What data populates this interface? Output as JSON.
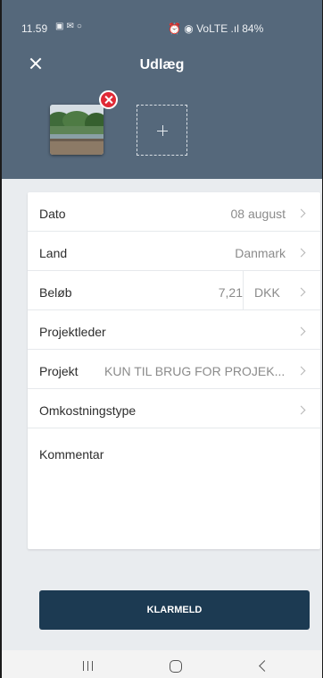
{
  "status_bar": {
    "time": "11.59",
    "left_icons": [
      "gallery-icon",
      "notification-icon",
      "voicemail-icon"
    ],
    "right_text": "⏰ ◉ VoLTE .ıl 84%",
    "battery": "84%"
  },
  "header": {
    "title": "Udlæg",
    "close_icon": "close-icon",
    "bg_color": "#55687b"
  },
  "attachments": {
    "photos": [
      {
        "icon": "photo-thumbnail"
      }
    ],
    "remove_icon": "remove-icon",
    "add_icon": "plus-icon"
  },
  "form": {
    "date": {
      "label": "Dato",
      "value": "08 august"
    },
    "country": {
      "label": "Land",
      "value": "Danmark"
    },
    "amount": {
      "label": "Beløb",
      "value": "7,21",
      "currency": "DKK"
    },
    "project_leader": {
      "label": "Projektleder",
      "value": ""
    },
    "project": {
      "label": "Projekt",
      "value": "KUN TIL BRUG FOR PROJEK..."
    },
    "cost_type": {
      "label": "Omkostningstype",
      "value": ""
    },
    "comment": {
      "label": "Kommentar",
      "value": ""
    }
  },
  "actions": {
    "submit_label": "KLARMELD",
    "button_color": "#1c3a52"
  },
  "nav_bar": {
    "items": [
      "recent-apps-icon",
      "home-icon",
      "back-icon"
    ]
  }
}
